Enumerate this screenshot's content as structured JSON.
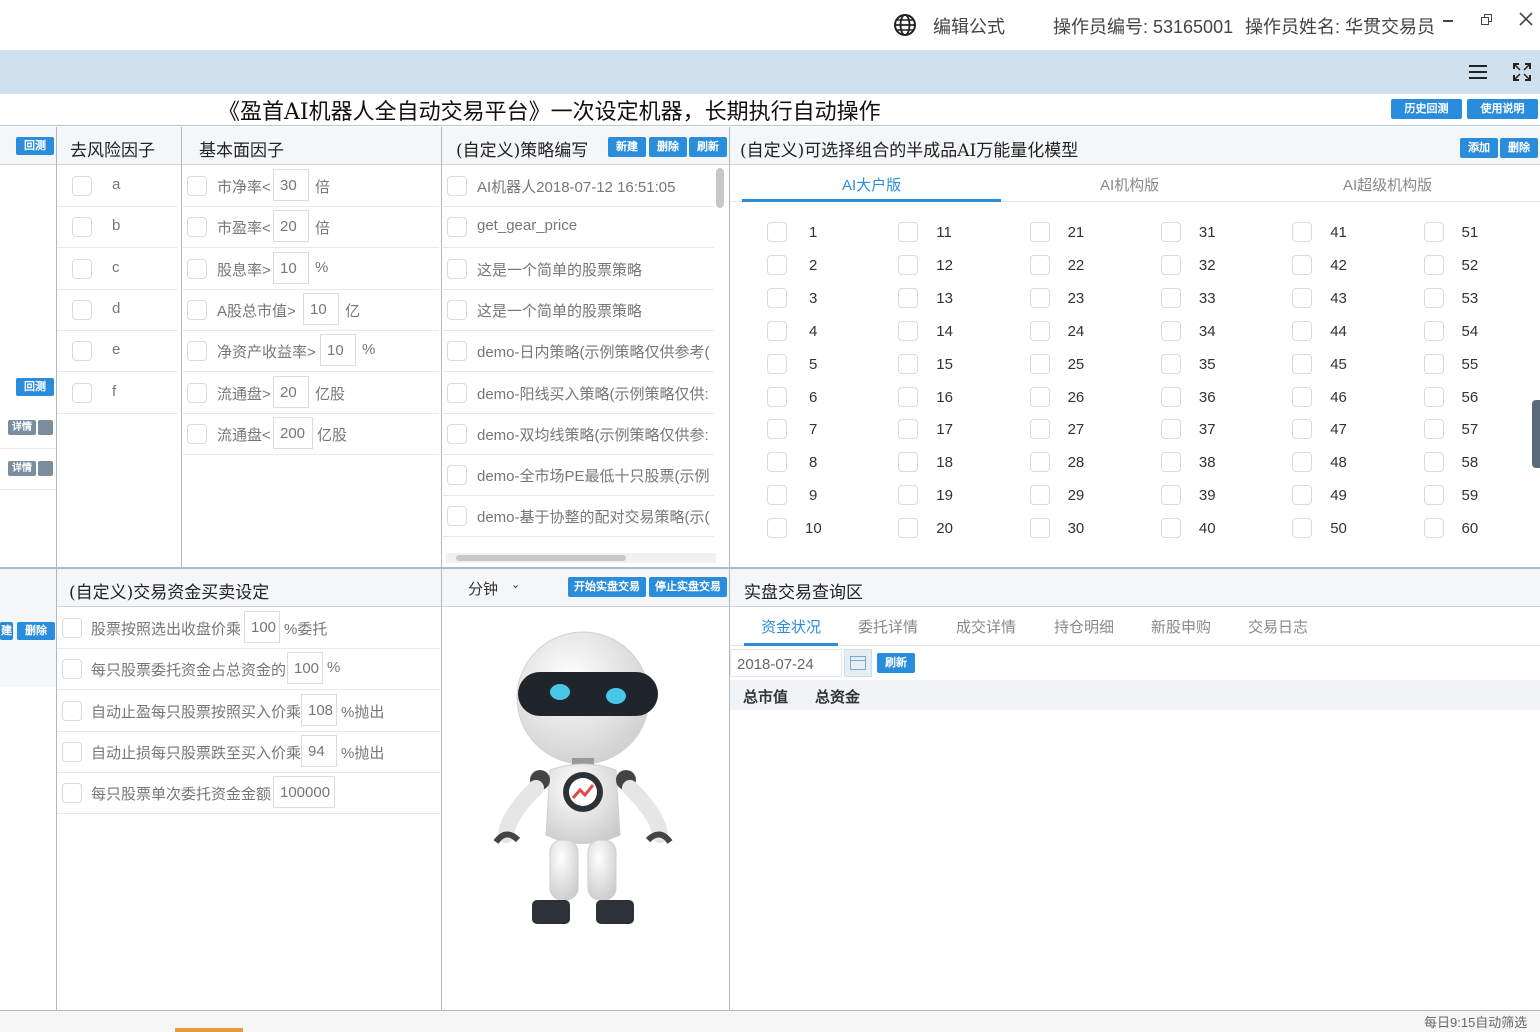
{
  "topbar": {
    "edit_formula": "编辑公式",
    "operator_id": "操作员编号: 53165001",
    "operator_name": "操作员姓名: 华贯交易员"
  },
  "main_title": "《盈首AI机器人全自动交易平台》一次设定机器，长期执行自动操作",
  "title_buttons": {
    "history": "历史回测",
    "manual": "使用说明"
  },
  "left_edge": {
    "backtest": "回测",
    "detail": "详情",
    "delete": "删除",
    "new": "建"
  },
  "risk": {
    "title": "去风险因子",
    "items": [
      "a",
      "b",
      "c",
      "d",
      "e",
      "f"
    ]
  },
  "fundamental": {
    "title": "基本面因子",
    "items": [
      {
        "label": "市净率<",
        "value": "30",
        "unit": "倍"
      },
      {
        "label": "市盈率<",
        "value": "20",
        "unit": "倍"
      },
      {
        "label": "股息率>",
        "value": "10",
        "unit": "%"
      },
      {
        "label": "A股总市值>",
        "value": "10",
        "unit": "亿"
      },
      {
        "label": "净资产收益率>",
        "value": "10",
        "unit": "%"
      },
      {
        "label": "流通盘>",
        "value": "20",
        "unit": "亿股"
      },
      {
        "label": "流通盘<",
        "value": "200",
        "unit": "亿股"
      }
    ]
  },
  "strategy": {
    "title": "(自定义)策略编写",
    "buttons": {
      "new": "新建",
      "delete": "删除",
      "refresh": "刷新"
    },
    "items": [
      "AI机器人2018-07-12 16:51:05",
      "get_gear_price",
      "这是一个简单的股票策略",
      "这是一个简单的股票策略",
      "demo-日内策略(示例策略仅供参考(",
      "demo-阳线买入策略(示例策略仅供:",
      "demo-双均线策略(示例策略仅供参:",
      "demo-全市场PE最低十只股票(示例",
      "demo-基于协整的配对交易策略(示("
    ]
  },
  "model": {
    "title": "(自定义)可选择组合的半成品AI万能量化模型",
    "buttons": {
      "add": "添加",
      "delete": "删除"
    },
    "tabs": [
      "AI大户版",
      "AI机构版",
      "AI超级机构版"
    ],
    "active_tab": "AI大户版",
    "columns": [
      [
        "1",
        "2",
        "3",
        "4",
        "5",
        "6",
        "7",
        "8",
        "9",
        "10"
      ],
      [
        "11",
        "12",
        "13",
        "14",
        "15",
        "16",
        "17",
        "18",
        "19",
        "20"
      ],
      [
        "21",
        "22",
        "23",
        "24",
        "25",
        "26",
        "27",
        "28",
        "29",
        "30"
      ],
      [
        "31",
        "32",
        "33",
        "34",
        "35",
        "36",
        "37",
        "38",
        "39",
        "40"
      ],
      [
        "41",
        "42",
        "43",
        "44",
        "45",
        "46",
        "47",
        "48",
        "49",
        "50"
      ],
      [
        "51",
        "52",
        "53",
        "54",
        "55",
        "56",
        "57",
        "58",
        "59",
        "60"
      ]
    ]
  },
  "funds": {
    "title": "(自定义)交易资金买卖设定",
    "items": [
      {
        "label": "股票按照选出收盘价乘",
        "value": "100",
        "unit": "%委托"
      },
      {
        "label": "每只股票委托资金占总资金的",
        "value": "100",
        "unit": "%"
      },
      {
        "label": "自动止盈每只股票按照买入价乘",
        "value": "108",
        "unit": "%抛出"
      },
      {
        "label": "自动止损每只股票跌至买入价乘",
        "value": "94",
        "unit": "%抛出"
      },
      {
        "label": "每只股票单次委托资金金额",
        "value": "100000",
        "unit": ""
      }
    ]
  },
  "robot": {
    "interval": "分钟",
    "start": "开始实盘交易",
    "stop": "停止实盘交易"
  },
  "query": {
    "title": "实盘交易查询区",
    "tabs": [
      "资金状况",
      "委托详情",
      "成交详情",
      "持仓明细",
      "新股申购",
      "交易日志"
    ],
    "active_tab": "资金状况",
    "date": "2018-07-24",
    "refresh": "刷新",
    "columns": [
      "总市值",
      "总资金"
    ]
  },
  "footer": "每日9:15自动筛选",
  "colors": {
    "accent": "#2a8ddb",
    "band": "#cfe0ec"
  }
}
